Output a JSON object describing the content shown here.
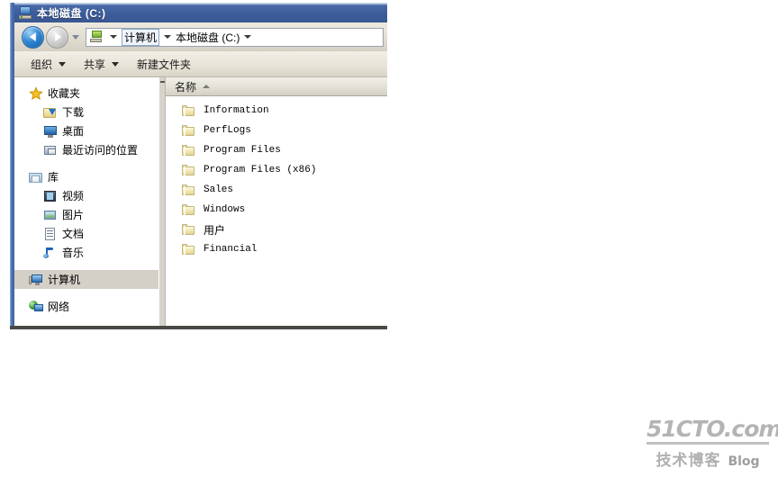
{
  "window": {
    "title": "本地磁盘 (C:)",
    "title_icon": "local-disk-icon",
    "colors": {
      "titlebar": "#3c5c9b",
      "toolbar": "#e6e2d6",
      "pane_bg": "#ffffff",
      "selection": "#d4d0c8",
      "folder_icon": "#f2e9b8"
    }
  },
  "address_bar": {
    "back_icon": "back-arrow-icon",
    "forward_icon": "forward-arrow-icon",
    "history_icon": "chevron-down-icon",
    "path_icon": "computer-icon",
    "crumbs": [
      {
        "label": "计算机",
        "hovered": true
      },
      {
        "label": "本地磁盘 (C:)",
        "hovered": false
      }
    ]
  },
  "toolbar": {
    "items": [
      {
        "label": "组织",
        "has_caret": true
      },
      {
        "label": "共享",
        "has_caret": true
      },
      {
        "label": "新建文件夹",
        "has_caret": false
      }
    ]
  },
  "nav_pane": {
    "groups": [
      {
        "header": {
          "label": "收藏夹",
          "icon": "star-icon"
        },
        "items": [
          {
            "label": "下载",
            "icon": "download-folder-icon"
          },
          {
            "label": "桌面",
            "icon": "desktop-icon"
          },
          {
            "label": "最近访问的位置",
            "icon": "recent-places-icon"
          }
        ]
      },
      {
        "header": {
          "label": "库",
          "icon": "library-icon"
        },
        "items": [
          {
            "label": "视频",
            "icon": "video-icon"
          },
          {
            "label": "图片",
            "icon": "picture-icon"
          },
          {
            "label": "文档",
            "icon": "document-icon"
          },
          {
            "label": "音乐",
            "icon": "music-icon"
          }
        ]
      }
    ],
    "roots": [
      {
        "label": "计算机",
        "icon": "computer-icon",
        "selected": true
      },
      {
        "label": "网络",
        "icon": "network-icon",
        "selected": false
      }
    ]
  },
  "list_pane": {
    "columns": [
      {
        "label": "名称",
        "sort": "asc"
      }
    ],
    "rows": [
      {
        "name": "Information",
        "icon": "folder-icon",
        "cjk": false
      },
      {
        "name": "PerfLogs",
        "icon": "folder-icon",
        "cjk": false
      },
      {
        "name": "Program Files",
        "icon": "folder-icon",
        "cjk": false
      },
      {
        "name": "Program Files (x86)",
        "icon": "folder-icon",
        "cjk": false
      },
      {
        "name": "Sales",
        "icon": "folder-icon",
        "cjk": false
      },
      {
        "name": "Windows",
        "icon": "folder-icon",
        "cjk": false
      },
      {
        "name": "用户",
        "icon": "folder-icon",
        "cjk": true
      },
      {
        "name": "Financial",
        "icon": "folder-icon",
        "cjk": false
      }
    ]
  },
  "watermark": {
    "top": "51CTO.com",
    "bottom_cn": "技术博客",
    "bottom_en": "Blog"
  }
}
